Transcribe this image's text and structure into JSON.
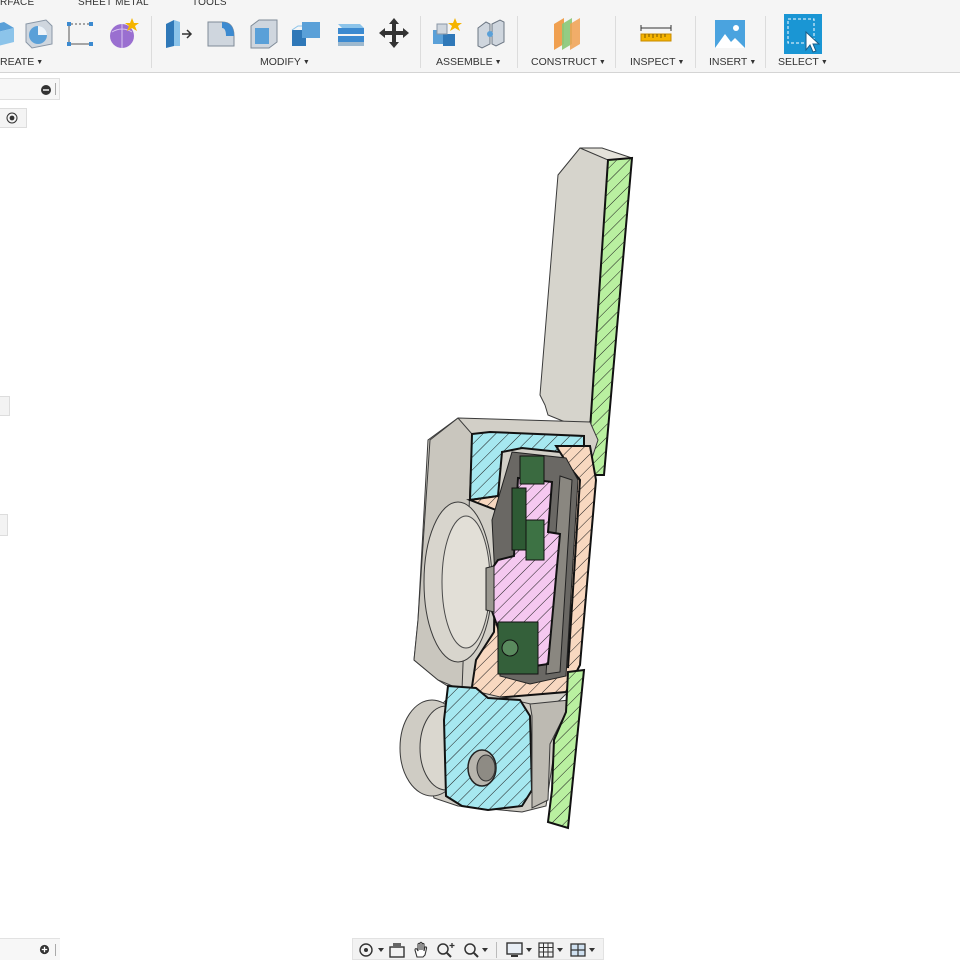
{
  "toolbar": {
    "tabs": [
      "RFACE",
      "SHEET METAL",
      "TOOLS"
    ],
    "groups": {
      "create": "REATE",
      "modify": "MODIFY",
      "assemble": "ASSEMBLE",
      "construct": "CONSTRUCT",
      "inspect": "INSPECT",
      "insert": "INSERT",
      "select": "SELECT"
    },
    "active_tool": "select"
  },
  "colors": {
    "select_accent": "#1a96d4",
    "section_green": "#b9f0a0",
    "section_cyan": "#a6e8f0",
    "section_peach": "#f8d8c0",
    "section_pink": "#f5c8f0",
    "body_gray": "#d6d4cc"
  },
  "viewport": {
    "model": "section-analysis-part"
  },
  "navigation_bar": {
    "tools": [
      "orbit-icon",
      "look-at-icon",
      "pan-icon",
      "zoom-icon",
      "fit-icon",
      "display-settings-icon",
      "grid-settings-icon",
      "viewports-icon"
    ]
  }
}
